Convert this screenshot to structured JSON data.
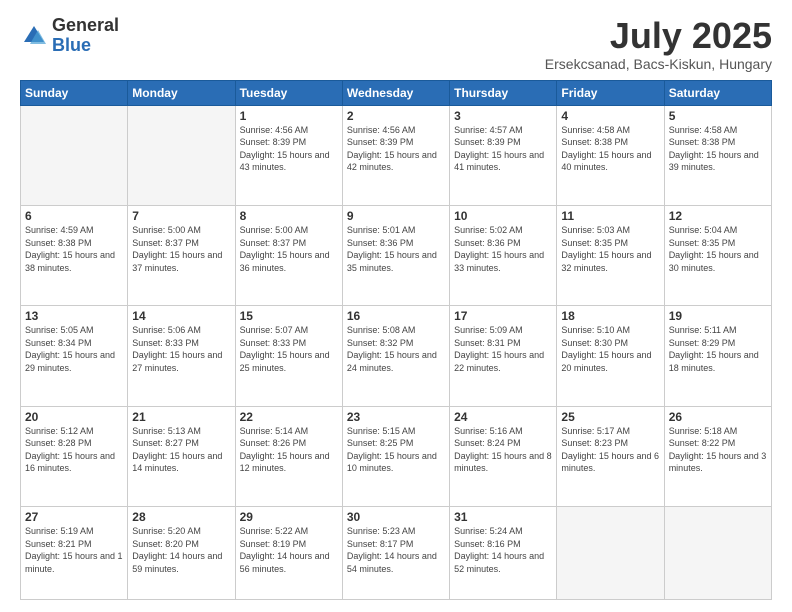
{
  "logo": {
    "general": "General",
    "blue": "Blue"
  },
  "header": {
    "title": "July 2025",
    "subtitle": "Ersekcsanad, Bacs-Kiskun, Hungary"
  },
  "weekdays": [
    "Sunday",
    "Monday",
    "Tuesday",
    "Wednesday",
    "Thursday",
    "Friday",
    "Saturday"
  ],
  "weeks": [
    [
      {
        "day": "",
        "info": ""
      },
      {
        "day": "",
        "info": ""
      },
      {
        "day": "1",
        "info": "Sunrise: 4:56 AM\nSunset: 8:39 PM\nDaylight: 15 hours\nand 43 minutes."
      },
      {
        "day": "2",
        "info": "Sunrise: 4:56 AM\nSunset: 8:39 PM\nDaylight: 15 hours\nand 42 minutes."
      },
      {
        "day": "3",
        "info": "Sunrise: 4:57 AM\nSunset: 8:39 PM\nDaylight: 15 hours\nand 41 minutes."
      },
      {
        "day": "4",
        "info": "Sunrise: 4:58 AM\nSunset: 8:38 PM\nDaylight: 15 hours\nand 40 minutes."
      },
      {
        "day": "5",
        "info": "Sunrise: 4:58 AM\nSunset: 8:38 PM\nDaylight: 15 hours\nand 39 minutes."
      }
    ],
    [
      {
        "day": "6",
        "info": "Sunrise: 4:59 AM\nSunset: 8:38 PM\nDaylight: 15 hours\nand 38 minutes."
      },
      {
        "day": "7",
        "info": "Sunrise: 5:00 AM\nSunset: 8:37 PM\nDaylight: 15 hours\nand 37 minutes."
      },
      {
        "day": "8",
        "info": "Sunrise: 5:00 AM\nSunset: 8:37 PM\nDaylight: 15 hours\nand 36 minutes."
      },
      {
        "day": "9",
        "info": "Sunrise: 5:01 AM\nSunset: 8:36 PM\nDaylight: 15 hours\nand 35 minutes."
      },
      {
        "day": "10",
        "info": "Sunrise: 5:02 AM\nSunset: 8:36 PM\nDaylight: 15 hours\nand 33 minutes."
      },
      {
        "day": "11",
        "info": "Sunrise: 5:03 AM\nSunset: 8:35 PM\nDaylight: 15 hours\nand 32 minutes."
      },
      {
        "day": "12",
        "info": "Sunrise: 5:04 AM\nSunset: 8:35 PM\nDaylight: 15 hours\nand 30 minutes."
      }
    ],
    [
      {
        "day": "13",
        "info": "Sunrise: 5:05 AM\nSunset: 8:34 PM\nDaylight: 15 hours\nand 29 minutes."
      },
      {
        "day": "14",
        "info": "Sunrise: 5:06 AM\nSunset: 8:33 PM\nDaylight: 15 hours\nand 27 minutes."
      },
      {
        "day": "15",
        "info": "Sunrise: 5:07 AM\nSunset: 8:33 PM\nDaylight: 15 hours\nand 25 minutes."
      },
      {
        "day": "16",
        "info": "Sunrise: 5:08 AM\nSunset: 8:32 PM\nDaylight: 15 hours\nand 24 minutes."
      },
      {
        "day": "17",
        "info": "Sunrise: 5:09 AM\nSunset: 8:31 PM\nDaylight: 15 hours\nand 22 minutes."
      },
      {
        "day": "18",
        "info": "Sunrise: 5:10 AM\nSunset: 8:30 PM\nDaylight: 15 hours\nand 20 minutes."
      },
      {
        "day": "19",
        "info": "Sunrise: 5:11 AM\nSunset: 8:29 PM\nDaylight: 15 hours\nand 18 minutes."
      }
    ],
    [
      {
        "day": "20",
        "info": "Sunrise: 5:12 AM\nSunset: 8:28 PM\nDaylight: 15 hours\nand 16 minutes."
      },
      {
        "day": "21",
        "info": "Sunrise: 5:13 AM\nSunset: 8:27 PM\nDaylight: 15 hours\nand 14 minutes."
      },
      {
        "day": "22",
        "info": "Sunrise: 5:14 AM\nSunset: 8:26 PM\nDaylight: 15 hours\nand 12 minutes."
      },
      {
        "day": "23",
        "info": "Sunrise: 5:15 AM\nSunset: 8:25 PM\nDaylight: 15 hours\nand 10 minutes."
      },
      {
        "day": "24",
        "info": "Sunrise: 5:16 AM\nSunset: 8:24 PM\nDaylight: 15 hours\nand 8 minutes."
      },
      {
        "day": "25",
        "info": "Sunrise: 5:17 AM\nSunset: 8:23 PM\nDaylight: 15 hours\nand 6 minutes."
      },
      {
        "day": "26",
        "info": "Sunrise: 5:18 AM\nSunset: 8:22 PM\nDaylight: 15 hours\nand 3 minutes."
      }
    ],
    [
      {
        "day": "27",
        "info": "Sunrise: 5:19 AM\nSunset: 8:21 PM\nDaylight: 15 hours\nand 1 minute."
      },
      {
        "day": "28",
        "info": "Sunrise: 5:20 AM\nSunset: 8:20 PM\nDaylight: 14 hours\nand 59 minutes."
      },
      {
        "day": "29",
        "info": "Sunrise: 5:22 AM\nSunset: 8:19 PM\nDaylight: 14 hours\nand 56 minutes."
      },
      {
        "day": "30",
        "info": "Sunrise: 5:23 AM\nSunset: 8:17 PM\nDaylight: 14 hours\nand 54 minutes."
      },
      {
        "day": "31",
        "info": "Sunrise: 5:24 AM\nSunset: 8:16 PM\nDaylight: 14 hours\nand 52 minutes."
      },
      {
        "day": "",
        "info": ""
      },
      {
        "day": "",
        "info": ""
      }
    ]
  ]
}
